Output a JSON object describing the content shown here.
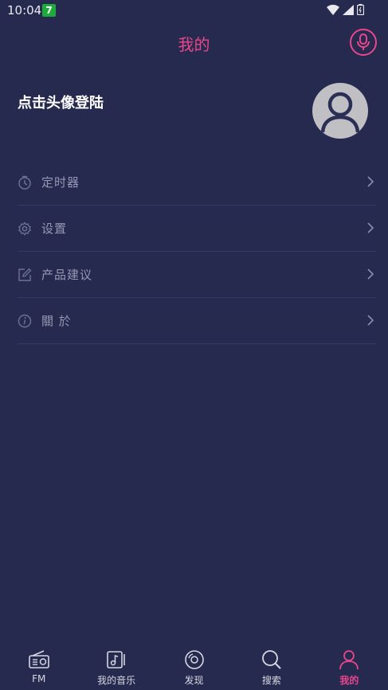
{
  "status_bar": {
    "time": "10:04",
    "app_badge": "7"
  },
  "header": {
    "title": "我的"
  },
  "profile": {
    "login_prompt": "点击头像登陆"
  },
  "menu": {
    "items": [
      {
        "label": "定时器",
        "icon": "timer-icon"
      },
      {
        "label": "设置",
        "icon": "gear-icon"
      },
      {
        "label": "产品建议",
        "icon": "edit-icon"
      },
      {
        "label": "關 於",
        "icon": "info-icon"
      }
    ]
  },
  "bottom_nav": {
    "items": [
      {
        "label": "FM",
        "icon": "radio-icon"
      },
      {
        "label": "我的音乐",
        "icon": "music-note-icon"
      },
      {
        "label": "发现",
        "icon": "disc-icon"
      },
      {
        "label": "搜索",
        "icon": "search-icon"
      },
      {
        "label": "我的",
        "icon": "user-icon"
      }
    ],
    "active": "我的"
  },
  "colors": {
    "background": "#272a4f",
    "accent": "#e8468c",
    "muted_text": "#9598b3"
  }
}
